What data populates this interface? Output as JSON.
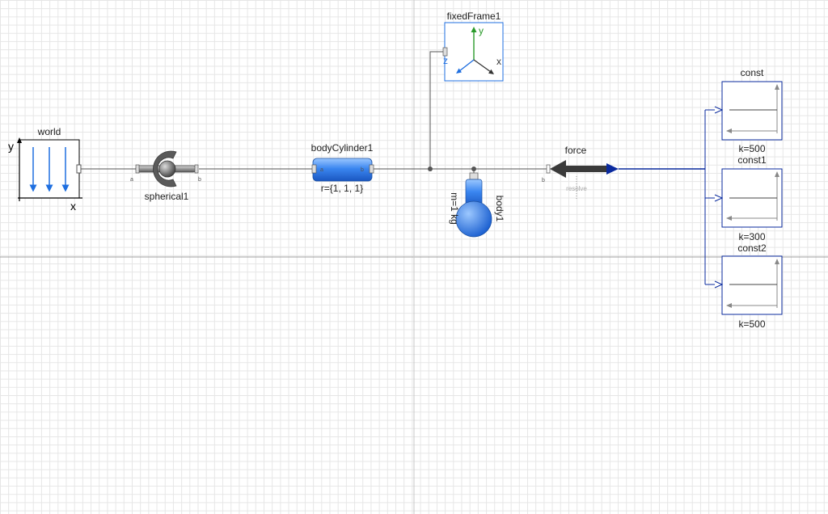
{
  "components": {
    "world": {
      "name": "world",
      "axis_x": "x",
      "axis_y": "y"
    },
    "spherical": {
      "name": "spherical1",
      "port_a": "a",
      "port_b": "b"
    },
    "bodyCylinder": {
      "name": "bodyCylinder1",
      "param": "r={1, 1, 1}",
      "port_a": "a",
      "port_b": "b"
    },
    "fixedFrame": {
      "name": "fixedFrame1",
      "axis_x": "x",
      "axis_y": "y",
      "axis_z": "z"
    },
    "body": {
      "name": "body1",
      "param": "m=1 kg"
    },
    "force": {
      "name": "force",
      "port_b": "b",
      "resolve": "resolve"
    },
    "const": {
      "name": "const",
      "param": "k=500"
    },
    "const1": {
      "name": "const1",
      "param": "k=300"
    },
    "const2": {
      "name": "const2",
      "param": "k=500"
    }
  },
  "colors": {
    "grid_line": "#e6e6e6",
    "major_line": "#a0a0a0",
    "connection": "#555555",
    "signal": "#0a2a9e",
    "accent_blue": "#1f6fe0",
    "frame_green": "#2a9a2a",
    "icon_gray": "#707070"
  }
}
